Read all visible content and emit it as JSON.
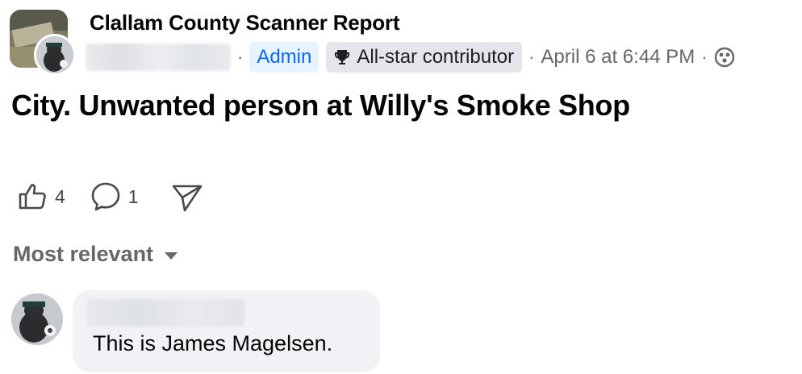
{
  "group": {
    "name": "Clallam County Scanner Report",
    "avatar_icon": "group-avatar-icon"
  },
  "post": {
    "author_blurred": true,
    "separator": "·",
    "admin_badge": "Admin",
    "allstar_badge": "All-star contributor",
    "timestamp": "April 6 at 6:44 PM",
    "privacy_icon": "group-members-icon",
    "text": "City. Unwanted person at Willy's Smoke Shop"
  },
  "actions": {
    "like_count": "4",
    "comment_count": "1",
    "like_icon": "thumbs-up-icon",
    "comment_icon": "comment-bubble-icon",
    "share_icon": "share-icon"
  },
  "comments": {
    "sort_label": "Most relevant",
    "items": [
      {
        "author_blurred": true,
        "text": "This is James Magelsen."
      }
    ]
  },
  "colors": {
    "admin_bg": "#e7f3ff",
    "admin_text": "#0866ff",
    "badge_bg": "#e4e6eb",
    "secondary_text": "#65676b",
    "bubble_bg": "#f0f2f5"
  }
}
